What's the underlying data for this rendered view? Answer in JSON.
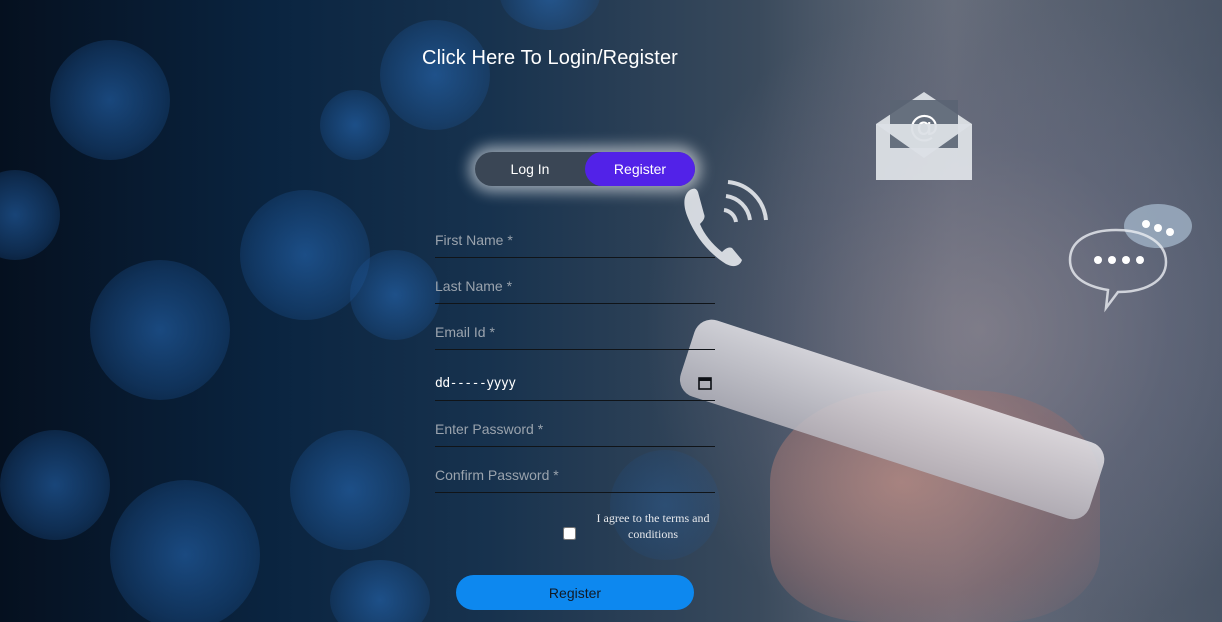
{
  "page": {
    "title": "Click Here To Login/Register"
  },
  "toggle": {
    "login_label": "Log In",
    "register_label": "Register",
    "active": "Register",
    "active_color": "#5222e8"
  },
  "form": {
    "first_name": {
      "placeholder": "First Name *",
      "value": ""
    },
    "last_name": {
      "placeholder": "Last Name *",
      "value": ""
    },
    "email": {
      "placeholder": "Email Id *",
      "value": ""
    },
    "dob": {
      "display": "dd-----yyyy"
    },
    "password": {
      "placeholder": "Enter Password *",
      "value": ""
    },
    "confirm_password": {
      "placeholder": "Confirm Password *",
      "value": ""
    },
    "terms_label": "I agree to the terms and conditions",
    "terms_checked": false,
    "submit_label": "Register",
    "submit_color": "#0d88ef"
  },
  "icons": {
    "background_icons": [
      "email-icon",
      "phone-call-icon",
      "chat-bubble-icon",
      "calendar-icon"
    ]
  }
}
